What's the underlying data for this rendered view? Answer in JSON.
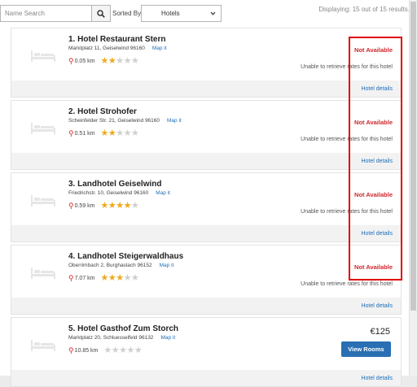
{
  "toolbar": {
    "search_placeholder": "Name Search",
    "sorted_by_label": "Sorted By:",
    "sort_value": "Hotels",
    "displaying_text": "Displaying: 15 out of 15 results."
  },
  "hotels": [
    {
      "name": "1. Hotel Restaurant Stern",
      "address": "Marktplatz 11, Geiselwind 96160",
      "map_link": "Map it",
      "distance": "0.05 km",
      "stars": "2",
      "status": "Not Available",
      "message": "Unable to retrieve rates for this hotel",
      "details_link": "Hotel details"
    },
    {
      "name": "2. Hotel Strohofer",
      "address": "Scheinfelder Str. 21, Geiselwind 96160",
      "map_link": "Map it",
      "distance": "0.51 km",
      "stars": "2",
      "status": "Not Available",
      "message": "Unable to retrieve rates for this hotel",
      "details_link": "Hotel details"
    },
    {
      "name": "3. Landhotel Geiselwind",
      "address": "Friedrichstr. 10, Geiselwind 96160",
      "map_link": "Map it",
      "distance": "0.59 km",
      "stars": "4",
      "status": "Not Available",
      "message": "Unable to retrieve rates for this hotel",
      "details_link": "Hotel details"
    },
    {
      "name": "4. Landhotel Steigerwaldhaus",
      "address": "Oberrimbach 2, Burghaslach 96152",
      "map_link": "Map it",
      "distance": "7.07 km",
      "stars": "3",
      "status": "Not Available",
      "message": "Unable to retrieve rates for this hotel",
      "details_link": "Hotel details"
    },
    {
      "name": "5. Hotel Gasthof Zum Storch",
      "address": "Marktplatz 20, Schluesselfeld 96132",
      "map_link": "Map it",
      "distance": "10.85 km",
      "stars": "0",
      "price": "€125",
      "button_label": "View Rooms",
      "details_link": "Hotel details"
    }
  ],
  "colors": {
    "star": "#f0a81a",
    "status_red": "#d0262d",
    "link_blue": "#1e6fb8",
    "button_blue": "#2a6fb3",
    "highlight": "#e00000"
  }
}
